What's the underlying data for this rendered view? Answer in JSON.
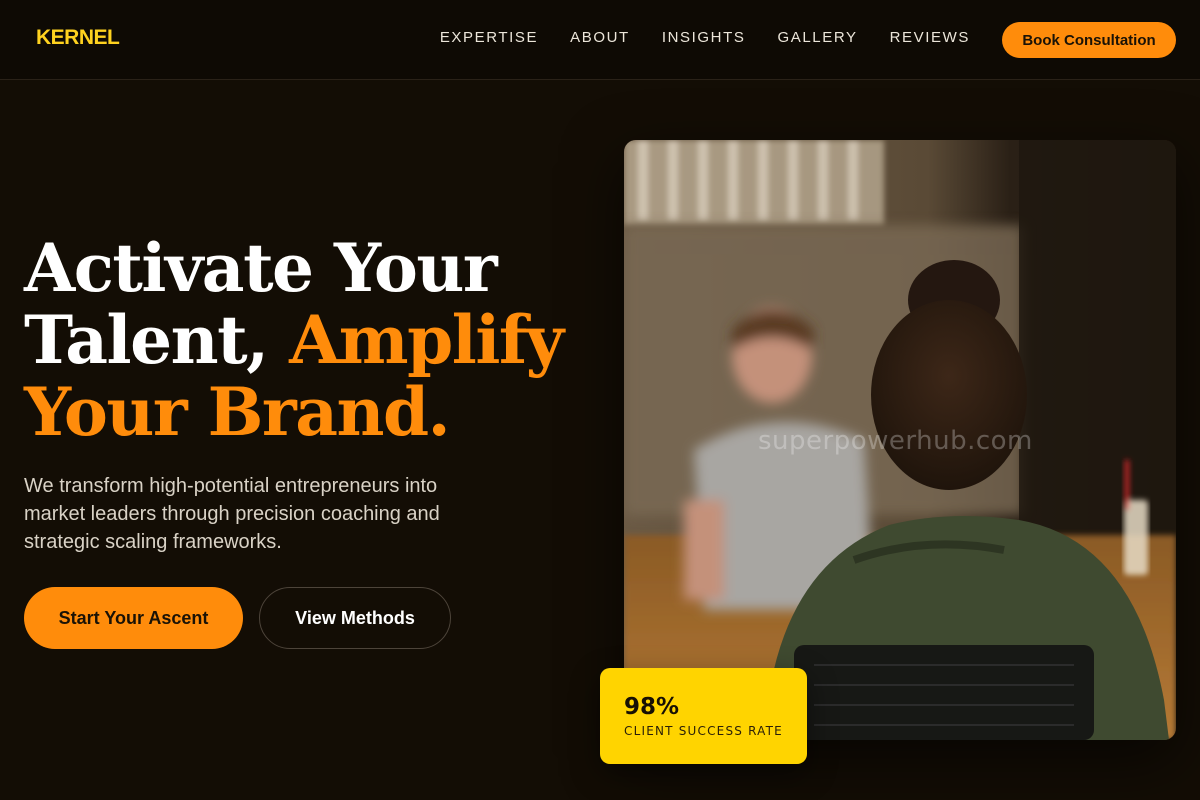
{
  "brand": {
    "logo": "KERNEL",
    "accent_color": "#ff8c0b",
    "logo_color": "#ffd21f"
  },
  "nav": {
    "items": [
      {
        "label": "EXPERTISE"
      },
      {
        "label": "ABOUT"
      },
      {
        "label": "INSIGHTS"
      },
      {
        "label": "GALLERY"
      },
      {
        "label": "REVIEWS"
      }
    ],
    "cta_label": "Book Consultation"
  },
  "hero": {
    "headline_line1": "Activate Your",
    "headline_line2_white": "Talent, ",
    "headline_line2_accent": "Amplify",
    "headline_line3_accent": "Your Brand.",
    "subtext": "We transform high-potential entrepreneurs into market leaders through precision coaching and strategic scaling frameworks.",
    "primary_button": "Start Your Ascent",
    "secondary_button": "View Methods"
  },
  "image": {
    "watermark": "superpowerhub.com"
  },
  "stat": {
    "value": "98%",
    "label": "CLIENT SUCCESS RATE",
    "card_color": "#ffd400"
  }
}
